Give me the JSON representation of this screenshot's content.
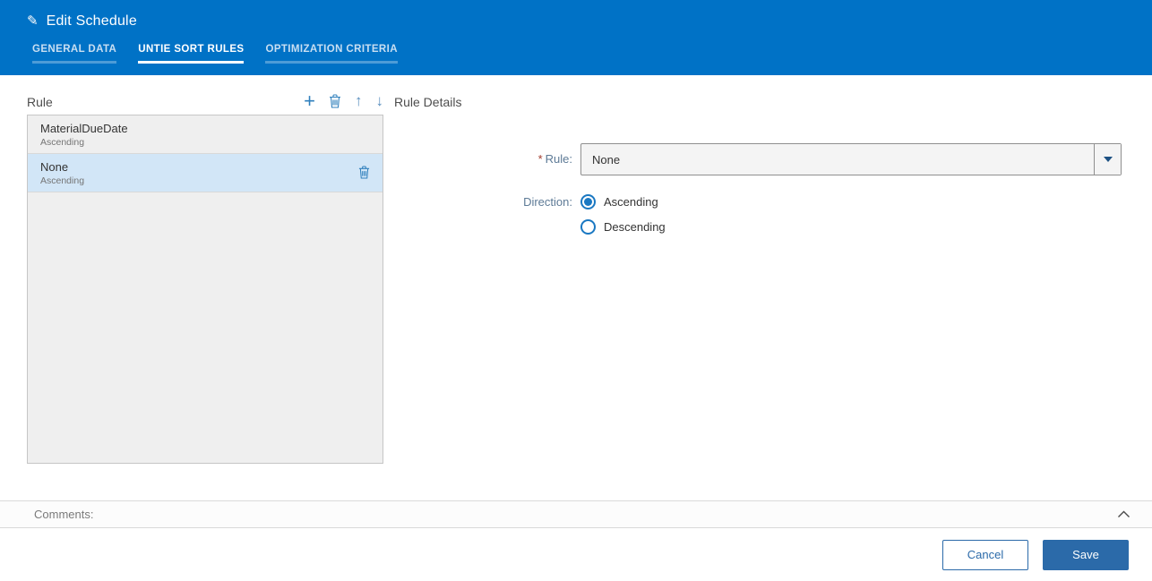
{
  "header": {
    "title": "Edit Schedule",
    "tabs": [
      {
        "label": "GENERAL DATA"
      },
      {
        "label": "UNTIE SORT RULES"
      },
      {
        "label": "OPTIMIZATION CRITERIA"
      }
    ],
    "active_tab": "UNTIE SORT RULES",
    "icons": {
      "edit": "✎"
    }
  },
  "rule_list": {
    "title": "Rule",
    "toolbar_icons": {
      "add": "+",
      "delete": "trash-icon",
      "move_up": "↑",
      "move_down": "↓"
    },
    "items": [
      {
        "name": "MaterialDueDate",
        "direction": "Ascending",
        "selected": false
      },
      {
        "name": "None",
        "direction": "Ascending",
        "selected": true
      }
    ]
  },
  "rule_details": {
    "title": "Rule Details",
    "required_marker": "*",
    "fields": {
      "rule": {
        "label": "Rule:",
        "required": true,
        "value": "None"
      },
      "direction": {
        "label": "Direction:",
        "options": [
          "Ascending",
          "Descending"
        ],
        "selected": "Ascending"
      }
    }
  },
  "comments": {
    "label": "Comments:"
  },
  "footer": {
    "cancel_label": "Cancel",
    "save_label": "Save"
  },
  "colors": {
    "header_blue": "#0072C6",
    "accent_blue": "#3080BD",
    "button_blue": "#2B6AA9",
    "selected_item_bg": "#D2E6F7",
    "required_red": "#A23C2E"
  }
}
